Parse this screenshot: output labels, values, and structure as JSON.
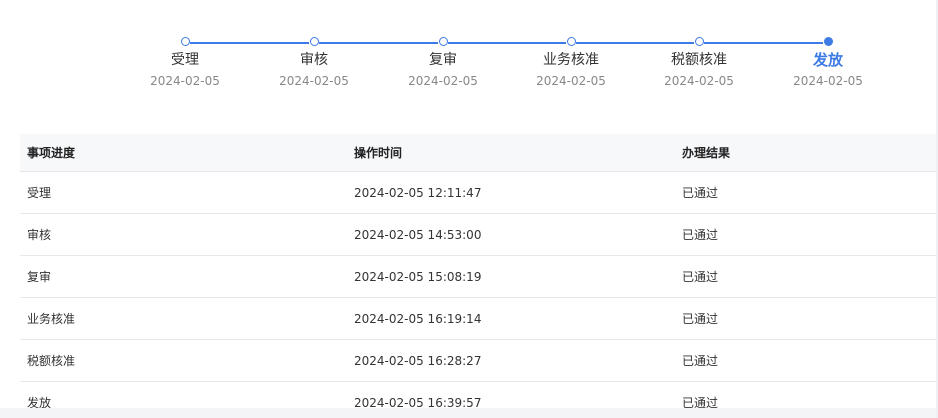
{
  "steps": [
    {
      "label": "受理",
      "date": "2024-02-05",
      "active": false
    },
    {
      "label": "审核",
      "date": "2024-02-05",
      "active": false
    },
    {
      "label": "复审",
      "date": "2024-02-05",
      "active": false
    },
    {
      "label": "业务核准",
      "date": "2024-02-05",
      "active": false
    },
    {
      "label": "税额核准",
      "date": "2024-02-05",
      "active": false
    },
    {
      "label": "发放",
      "date": "2024-02-05",
      "active": true
    }
  ],
  "table": {
    "headers": [
      "事项进度",
      "操作时间",
      "办理结果"
    ],
    "rows": [
      [
        "受理",
        "2024-02-05 12:11:47",
        "已通过"
      ],
      [
        "审核",
        "2024-02-05 14:53:00",
        "已通过"
      ],
      [
        "复审",
        "2024-02-05 15:08:19",
        "已通过"
      ],
      [
        "业务核准",
        "2024-02-05 16:19:14",
        "已通过"
      ],
      [
        "税额核准",
        "2024-02-05 16:28:27",
        "已通过"
      ],
      [
        "发放",
        "2024-02-05 16:39:57",
        "已通过"
      ]
    ]
  },
  "colors": {
    "accent": "#3d7be6",
    "header_bg": "#f7f8fa"
  }
}
